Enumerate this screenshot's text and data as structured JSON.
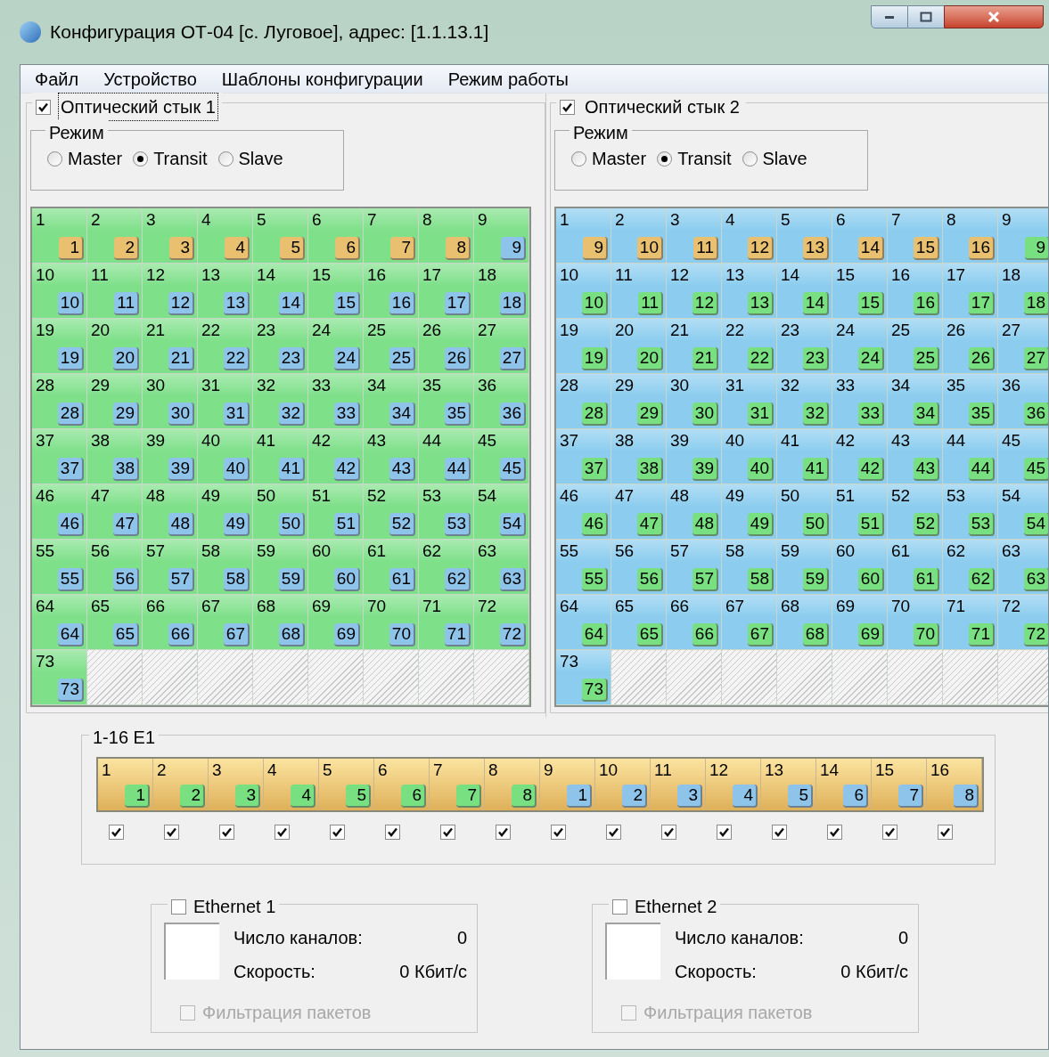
{
  "window": {
    "title": "Конфигурация ОТ-04 [с. Луговое], адрес: [1.1.13.1]"
  },
  "menu": [
    "Файл",
    "Устройство",
    "Шаблоны конфигурации",
    "Режим работы"
  ],
  "optical": [
    {
      "title": "Оптический стык 1",
      "checked": true,
      "focused": true,
      "color": "#7fe08a",
      "mode_label": "Режим",
      "modes": [
        {
          "label": "Master",
          "selected": false
        },
        {
          "label": "Transit",
          "selected": true
        },
        {
          "label": "Slave",
          "selected": false
        }
      ],
      "cells": [
        {
          "label": "1",
          "badge": "1",
          "color": "#e8c070"
        },
        {
          "label": "2",
          "badge": "2",
          "color": "#e8c070"
        },
        {
          "label": "3",
          "badge": "3",
          "color": "#e8c070"
        },
        {
          "label": "4",
          "badge": "4",
          "color": "#e8c070"
        },
        {
          "label": "5",
          "badge": "5",
          "color": "#e8c070"
        },
        {
          "label": "6",
          "badge": "6",
          "color": "#e8c070"
        },
        {
          "label": "7",
          "badge": "7",
          "color": "#e8c070"
        },
        {
          "label": "8",
          "badge": "8",
          "color": "#e8c070"
        },
        {
          "label": "9",
          "badge": "9",
          "color": "#8ec4ea"
        },
        {
          "label": "10",
          "badge": "10",
          "color": "#8ec4ea"
        },
        {
          "label": "11",
          "badge": "11",
          "color": "#8ec4ea"
        },
        {
          "label": "12",
          "badge": "12",
          "color": "#8ec4ea"
        },
        {
          "label": "13",
          "badge": "13",
          "color": "#8ec4ea"
        },
        {
          "label": "14",
          "badge": "14",
          "color": "#8ec4ea"
        },
        {
          "label": "15",
          "badge": "15",
          "color": "#8ec4ea"
        },
        {
          "label": "16",
          "badge": "16",
          "color": "#8ec4ea"
        },
        {
          "label": "17",
          "badge": "17",
          "color": "#8ec4ea"
        },
        {
          "label": "18",
          "badge": "18",
          "color": "#8ec4ea"
        },
        {
          "label": "19",
          "badge": "19",
          "color": "#8ec4ea"
        },
        {
          "label": "20",
          "badge": "20",
          "color": "#8ec4ea"
        },
        {
          "label": "21",
          "badge": "21",
          "color": "#8ec4ea"
        },
        {
          "label": "22",
          "badge": "22",
          "color": "#8ec4ea"
        },
        {
          "label": "23",
          "badge": "23",
          "color": "#8ec4ea"
        },
        {
          "label": "24",
          "badge": "24",
          "color": "#8ec4ea"
        },
        {
          "label": "25",
          "badge": "25",
          "color": "#8ec4ea"
        },
        {
          "label": "26",
          "badge": "26",
          "color": "#8ec4ea"
        },
        {
          "label": "27",
          "badge": "27",
          "color": "#8ec4ea"
        },
        {
          "label": "28",
          "badge": "28",
          "color": "#8ec4ea"
        },
        {
          "label": "29",
          "badge": "29",
          "color": "#8ec4ea"
        },
        {
          "label": "30",
          "badge": "30",
          "color": "#8ec4ea"
        },
        {
          "label": "31",
          "badge": "31",
          "color": "#8ec4ea"
        },
        {
          "label": "32",
          "badge": "32",
          "color": "#8ec4ea"
        },
        {
          "label": "33",
          "badge": "33",
          "color": "#8ec4ea"
        },
        {
          "label": "34",
          "badge": "34",
          "color": "#8ec4ea"
        },
        {
          "label": "35",
          "badge": "35",
          "color": "#8ec4ea"
        },
        {
          "label": "36",
          "badge": "36",
          "color": "#8ec4ea"
        },
        {
          "label": "37",
          "badge": "37",
          "color": "#8ec4ea"
        },
        {
          "label": "38",
          "badge": "38",
          "color": "#8ec4ea"
        },
        {
          "label": "39",
          "badge": "39",
          "color": "#8ec4ea"
        },
        {
          "label": "40",
          "badge": "40",
          "color": "#8ec4ea"
        },
        {
          "label": "41",
          "badge": "41",
          "color": "#8ec4ea"
        },
        {
          "label": "42",
          "badge": "42",
          "color": "#8ec4ea"
        },
        {
          "label": "43",
          "badge": "43",
          "color": "#8ec4ea"
        },
        {
          "label": "44",
          "badge": "44",
          "color": "#8ec4ea"
        },
        {
          "label": "45",
          "badge": "45",
          "color": "#8ec4ea"
        },
        {
          "label": "46",
          "badge": "46",
          "color": "#8ec4ea"
        },
        {
          "label": "47",
          "badge": "47",
          "color": "#8ec4ea"
        },
        {
          "label": "48",
          "badge": "48",
          "color": "#8ec4ea"
        },
        {
          "label": "49",
          "badge": "49",
          "color": "#8ec4ea"
        },
        {
          "label": "50",
          "badge": "50",
          "color": "#8ec4ea"
        },
        {
          "label": "51",
          "badge": "51",
          "color": "#8ec4ea"
        },
        {
          "label": "52",
          "badge": "52",
          "color": "#8ec4ea"
        },
        {
          "label": "53",
          "badge": "53",
          "color": "#8ec4ea"
        },
        {
          "label": "54",
          "badge": "54",
          "color": "#8ec4ea"
        },
        {
          "label": "55",
          "badge": "55",
          "color": "#8ec4ea"
        },
        {
          "label": "56",
          "badge": "56",
          "color": "#8ec4ea"
        },
        {
          "label": "57",
          "badge": "57",
          "color": "#8ec4ea"
        },
        {
          "label": "58",
          "badge": "58",
          "color": "#8ec4ea"
        },
        {
          "label": "59",
          "badge": "59",
          "color": "#8ec4ea"
        },
        {
          "label": "60",
          "badge": "60",
          "color": "#8ec4ea"
        },
        {
          "label": "61",
          "badge": "61",
          "color": "#8ec4ea"
        },
        {
          "label": "62",
          "badge": "62",
          "color": "#8ec4ea"
        },
        {
          "label": "63",
          "badge": "63",
          "color": "#8ec4ea"
        },
        {
          "label": "64",
          "badge": "64",
          "color": "#8ec4ea"
        },
        {
          "label": "65",
          "badge": "65",
          "color": "#8ec4ea"
        },
        {
          "label": "66",
          "badge": "66",
          "color": "#8ec4ea"
        },
        {
          "label": "67",
          "badge": "67",
          "color": "#8ec4ea"
        },
        {
          "label": "68",
          "badge": "68",
          "color": "#8ec4ea"
        },
        {
          "label": "69",
          "badge": "69",
          "color": "#8ec4ea"
        },
        {
          "label": "70",
          "badge": "70",
          "color": "#8ec4ea"
        },
        {
          "label": "71",
          "badge": "71",
          "color": "#8ec4ea"
        },
        {
          "label": "72",
          "badge": "72",
          "color": "#8ec4ea"
        },
        {
          "label": "73",
          "badge": "73",
          "color": "#8ec4ea"
        }
      ]
    },
    {
      "title": "Оптический стык 2",
      "checked": true,
      "focused": false,
      "color": "#8ccdef",
      "mode_label": "Режим",
      "modes": [
        {
          "label": "Master",
          "selected": false
        },
        {
          "label": "Transit",
          "selected": true
        },
        {
          "label": "Slave",
          "selected": false
        }
      ],
      "cells": [
        {
          "label": "1",
          "badge": "9",
          "color": "#e8c070"
        },
        {
          "label": "2",
          "badge": "10",
          "color": "#e8c070"
        },
        {
          "label": "3",
          "badge": "11",
          "color": "#e8c070"
        },
        {
          "label": "4",
          "badge": "12",
          "color": "#e8c070"
        },
        {
          "label": "5",
          "badge": "13",
          "color": "#e8c070"
        },
        {
          "label": "6",
          "badge": "14",
          "color": "#e8c070"
        },
        {
          "label": "7",
          "badge": "15",
          "color": "#e8c070"
        },
        {
          "label": "8",
          "badge": "16",
          "color": "#e8c070"
        },
        {
          "label": "9",
          "badge": "9",
          "color": "#78e080"
        },
        {
          "label": "10",
          "badge": "10",
          "color": "#78e080"
        },
        {
          "label": "11",
          "badge": "11",
          "color": "#78e080"
        },
        {
          "label": "12",
          "badge": "12",
          "color": "#78e080"
        },
        {
          "label": "13",
          "badge": "13",
          "color": "#78e080"
        },
        {
          "label": "14",
          "badge": "14",
          "color": "#78e080"
        },
        {
          "label": "15",
          "badge": "15",
          "color": "#78e080"
        },
        {
          "label": "16",
          "badge": "16",
          "color": "#78e080"
        },
        {
          "label": "17",
          "badge": "17",
          "color": "#78e080"
        },
        {
          "label": "18",
          "badge": "18",
          "color": "#78e080"
        },
        {
          "label": "19",
          "badge": "19",
          "color": "#78e080"
        },
        {
          "label": "20",
          "badge": "20",
          "color": "#78e080"
        },
        {
          "label": "21",
          "badge": "21",
          "color": "#78e080"
        },
        {
          "label": "22",
          "badge": "22",
          "color": "#78e080"
        },
        {
          "label": "23",
          "badge": "23",
          "color": "#78e080"
        },
        {
          "label": "24",
          "badge": "24",
          "color": "#78e080"
        },
        {
          "label": "25",
          "badge": "25",
          "color": "#78e080"
        },
        {
          "label": "26",
          "badge": "26",
          "color": "#78e080"
        },
        {
          "label": "27",
          "badge": "27",
          "color": "#78e080"
        },
        {
          "label": "28",
          "badge": "28",
          "color": "#78e080"
        },
        {
          "label": "29",
          "badge": "29",
          "color": "#78e080"
        },
        {
          "label": "30",
          "badge": "30",
          "color": "#78e080"
        },
        {
          "label": "31",
          "badge": "31",
          "color": "#78e080"
        },
        {
          "label": "32",
          "badge": "32",
          "color": "#78e080"
        },
        {
          "label": "33",
          "badge": "33",
          "color": "#78e080"
        },
        {
          "label": "34",
          "badge": "34",
          "color": "#78e080"
        },
        {
          "label": "35",
          "badge": "35",
          "color": "#78e080"
        },
        {
          "label": "36",
          "badge": "36",
          "color": "#78e080"
        },
        {
          "label": "37",
          "badge": "37",
          "color": "#78e080"
        },
        {
          "label": "38",
          "badge": "38",
          "color": "#78e080"
        },
        {
          "label": "39",
          "badge": "39",
          "color": "#78e080"
        },
        {
          "label": "40",
          "badge": "40",
          "color": "#78e080"
        },
        {
          "label": "41",
          "badge": "41",
          "color": "#78e080"
        },
        {
          "label": "42",
          "badge": "42",
          "color": "#78e080"
        },
        {
          "label": "43",
          "badge": "43",
          "color": "#78e080"
        },
        {
          "label": "44",
          "badge": "44",
          "color": "#78e080"
        },
        {
          "label": "45",
          "badge": "45",
          "color": "#78e080"
        },
        {
          "label": "46",
          "badge": "46",
          "color": "#78e080"
        },
        {
          "label": "47",
          "badge": "47",
          "color": "#78e080"
        },
        {
          "label": "48",
          "badge": "48",
          "color": "#78e080"
        },
        {
          "label": "49",
          "badge": "49",
          "color": "#78e080"
        },
        {
          "label": "50",
          "badge": "50",
          "color": "#78e080"
        },
        {
          "label": "51",
          "badge": "51",
          "color": "#78e080"
        },
        {
          "label": "52",
          "badge": "52",
          "color": "#78e080"
        },
        {
          "label": "53",
          "badge": "53",
          "color": "#78e080"
        },
        {
          "label": "54",
          "badge": "54",
          "color": "#78e080"
        },
        {
          "label": "55",
          "badge": "55",
          "color": "#78e080"
        },
        {
          "label": "56",
          "badge": "56",
          "color": "#78e080"
        },
        {
          "label": "57",
          "badge": "57",
          "color": "#78e080"
        },
        {
          "label": "58",
          "badge": "58",
          "color": "#78e080"
        },
        {
          "label": "59",
          "badge": "59",
          "color": "#78e080"
        },
        {
          "label": "60",
          "badge": "60",
          "color": "#78e080"
        },
        {
          "label": "61",
          "badge": "61",
          "color": "#78e080"
        },
        {
          "label": "62",
          "badge": "62",
          "color": "#78e080"
        },
        {
          "label": "63",
          "badge": "63",
          "color": "#78e080"
        },
        {
          "label": "64",
          "badge": "64",
          "color": "#78e080"
        },
        {
          "label": "65",
          "badge": "65",
          "color": "#78e080"
        },
        {
          "label": "66",
          "badge": "66",
          "color": "#78e080"
        },
        {
          "label": "67",
          "badge": "67",
          "color": "#78e080"
        },
        {
          "label": "68",
          "badge": "68",
          "color": "#78e080"
        },
        {
          "label": "69",
          "badge": "69",
          "color": "#78e080"
        },
        {
          "label": "70",
          "badge": "70",
          "color": "#78e080"
        },
        {
          "label": "71",
          "badge": "71",
          "color": "#78e080"
        },
        {
          "label": "72",
          "badge": "72",
          "color": "#78e080"
        },
        {
          "label": "73",
          "badge": "73",
          "color": "#78e080"
        }
      ]
    }
  ],
  "e1": {
    "title": "1-16 E1",
    "cells": [
      {
        "label": "1",
        "badge": "1",
        "color": "#78e080",
        "checked": true
      },
      {
        "label": "2",
        "badge": "2",
        "color": "#78e080",
        "checked": true
      },
      {
        "label": "3",
        "badge": "3",
        "color": "#78e080",
        "checked": true
      },
      {
        "label": "4",
        "badge": "4",
        "color": "#78e080",
        "checked": true
      },
      {
        "label": "5",
        "badge": "5",
        "color": "#78e080",
        "checked": true
      },
      {
        "label": "6",
        "badge": "6",
        "color": "#78e080",
        "checked": true
      },
      {
        "label": "7",
        "badge": "7",
        "color": "#78e080",
        "checked": true
      },
      {
        "label": "8",
        "badge": "8",
        "color": "#78e080",
        "checked": true
      },
      {
        "label": "9",
        "badge": "1",
        "color": "#8ec4ea",
        "checked": true
      },
      {
        "label": "10",
        "badge": "2",
        "color": "#8ec4ea",
        "checked": true
      },
      {
        "label": "11",
        "badge": "3",
        "color": "#8ec4ea",
        "checked": true
      },
      {
        "label": "12",
        "badge": "4",
        "color": "#8ec4ea",
        "checked": true
      },
      {
        "label": "13",
        "badge": "5",
        "color": "#8ec4ea",
        "checked": true
      },
      {
        "label": "14",
        "badge": "6",
        "color": "#8ec4ea",
        "checked": true
      },
      {
        "label": "15",
        "badge": "7",
        "color": "#8ec4ea",
        "checked": true
      },
      {
        "label": "16",
        "badge": "8",
        "color": "#8ec4ea",
        "checked": true
      }
    ]
  },
  "ethernet": [
    {
      "title": "Ethernet 1",
      "checked": false,
      "channels_label": "Число каналов:",
      "channels": "0",
      "speed_label": "Скорость:",
      "speed": "0 Кбит/с",
      "filter": {
        "label": "Фильтрация пакетов",
        "checked": false,
        "disabled": true
      }
    },
    {
      "title": "Ethernet 2",
      "checked": false,
      "channels_label": "Число каналов:",
      "channels": "0",
      "speed_label": "Скорость:",
      "speed": "0 Кбит/с",
      "filter": {
        "label": "Фильтрация пакетов",
        "checked": false,
        "disabled": true
      }
    }
  ]
}
